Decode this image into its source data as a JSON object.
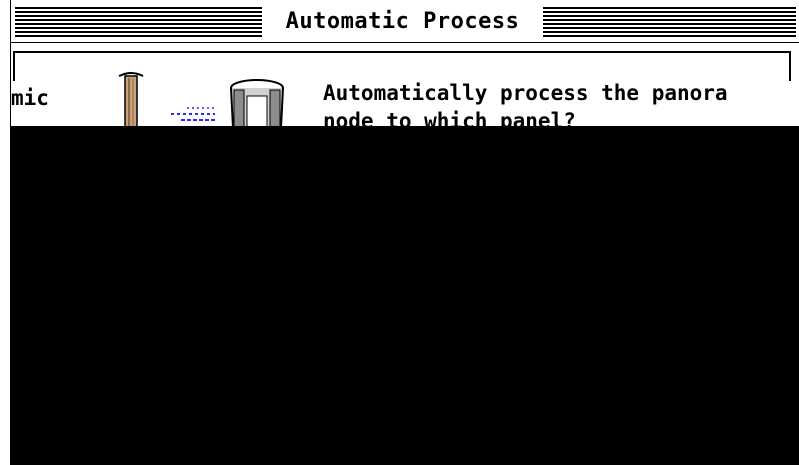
{
  "window": {
    "title": "Automatic Process"
  },
  "dialog": {
    "left_label": "mic",
    "prompt_line1": "Automatically process the panora",
    "prompt_line2": "node to which panel?"
  },
  "icons": {
    "pillar": "pillar-icon",
    "arrow": "dashed-arrow-icon",
    "cylinder": "panorama-cylinder-icon"
  },
  "colors": {
    "arrow": "#2a2aff",
    "pillar": "#8a6a4a",
    "cylinder": "#8c8c8c"
  }
}
